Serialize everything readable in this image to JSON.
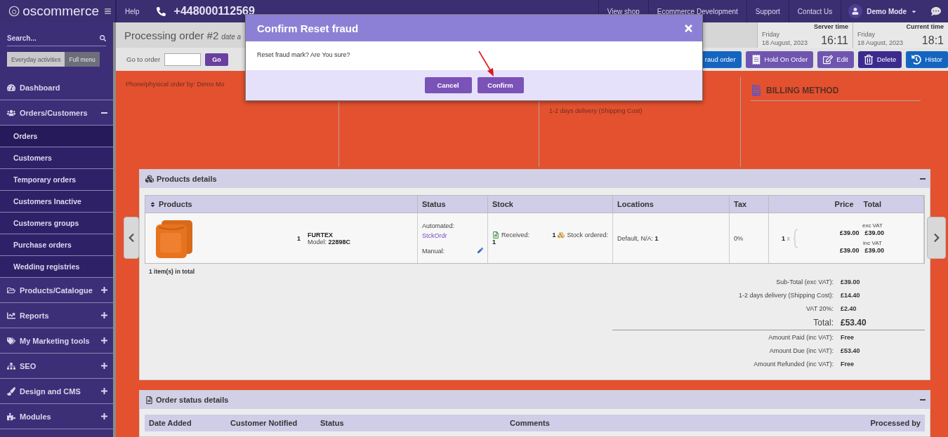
{
  "topbar": {
    "logo": "oscommerce",
    "help": "Help",
    "phone": "+448000112569",
    "links": [
      "View shop",
      "Ecommerce Development",
      "Support",
      "Contact Us"
    ],
    "user": "Demo Mode"
  },
  "sidebar": {
    "search": {
      "placeholder": "Search..."
    },
    "toggle": [
      {
        "label": "Everyday activities",
        "selected": false
      },
      {
        "label": "Full menu",
        "selected": true
      }
    ],
    "menu": [
      {
        "label": "Dashboard"
      },
      {
        "label": "Orders/Customers",
        "expanded": true,
        "children": [
          {
            "label": "Orders",
            "selected": true
          },
          {
            "label": "Customers",
            "selected": false
          },
          {
            "label": "Temporary orders",
            "selected": false
          },
          {
            "label": "Customers Inactive",
            "selected": false
          },
          {
            "label": "Customers groups",
            "selected": false
          },
          {
            "label": "Purchase orders",
            "selected": false
          },
          {
            "label": "Wedding registries",
            "selected": false
          }
        ]
      },
      {
        "label": "Products/Catalogue",
        "expanded": false
      },
      {
        "label": "Reports",
        "expanded": false
      },
      {
        "label": "My Marketing tools",
        "expanded": false
      },
      {
        "label": "SEO",
        "expanded": false
      },
      {
        "label": "Design and CMS",
        "expanded": false
      },
      {
        "label": "Modules",
        "expanded": false
      }
    ]
  },
  "page": {
    "title": "Processing order #2",
    "title_suffix": "date a",
    "clocks": [
      {
        "heading": "Server time",
        "day": "Friday",
        "date": "18 August, 2023",
        "time": "16:11"
      },
      {
        "heading": "Current time",
        "day": "Friday",
        "date": "18 August, 2023",
        "time": "18:1"
      }
    ],
    "goto": {
      "label": "Go to order",
      "button": "Go"
    },
    "actions": [
      {
        "label": "raud order",
        "kind": "blue"
      },
      {
        "label": "Hold On Order",
        "kind": "hold"
      },
      {
        "label": "Edit",
        "kind": "edit"
      },
      {
        "label": "Delete",
        "kind": "delete"
      },
      {
        "label": "Histor",
        "kind": "history"
      }
    ]
  },
  "info": {
    "order_by": "Phone/physical order by: Demo Mo",
    "shipping": "1-2 days delivery  (Shipping Cost)",
    "billing_heading": "BILLING METHOD"
  },
  "products": {
    "title": "Products details",
    "columns": [
      "Products",
      "Status",
      "Stock",
      "Locations",
      "Tax",
      "Price",
      "Total"
    ],
    "rows": [
      {
        "qty": "1",
        "name": "FURTEX",
        "model_label": "Model:",
        "model": "22898C",
        "status_auto": "Automated:",
        "status_link": "StckOrdr",
        "status_manual": "Manual:",
        "received_label": "Received:",
        "received": "1",
        "ordered_count": "1",
        "ordered_label": "Stock ordered:",
        "location_label": "Default, N/A:",
        "location": "1",
        "tax": "0%",
        "price_qty": "1",
        "price_x": "x",
        "exc_label": "exc VAT",
        "exc_price": "£39.00",
        "exc_total": "£39.00",
        "inc_label": "inc VAT",
        "inc_price": "£39.00",
        "inc_total": "£39.00"
      }
    ],
    "count": "1 item(s) in total",
    "totals": [
      {
        "label": "Sub-Total (exc VAT):",
        "value": "£39.00",
        "kind": "normal"
      },
      {
        "label": "1-2 days delivery  (Shipping Cost):",
        "value": "£14.40",
        "kind": "normal"
      },
      {
        "label": "VAT 20%:",
        "value": "£2.40",
        "kind": "normal"
      },
      {
        "label": "Total:",
        "value": "£53.40",
        "kind": "grand"
      },
      {
        "label": "Amount Paid (inc VAT):",
        "value": "Free",
        "kind": "normal"
      },
      {
        "label": "Amount Due (inc VAT):",
        "value": "£53.40",
        "kind": "normal"
      },
      {
        "label": "Amount Refunded (inc VAT):",
        "value": "Free",
        "kind": "normal"
      }
    ]
  },
  "status_details": {
    "title": "Order status details",
    "columns": [
      "Date Added",
      "Customer Notified",
      "Status",
      "Comments",
      "Processed by"
    ]
  },
  "dialog": {
    "title": "Confirm Reset fraud",
    "message": "Reset fraud mark? Are You sure?",
    "buttons": [
      "Cancel",
      "Confirm"
    ]
  }
}
